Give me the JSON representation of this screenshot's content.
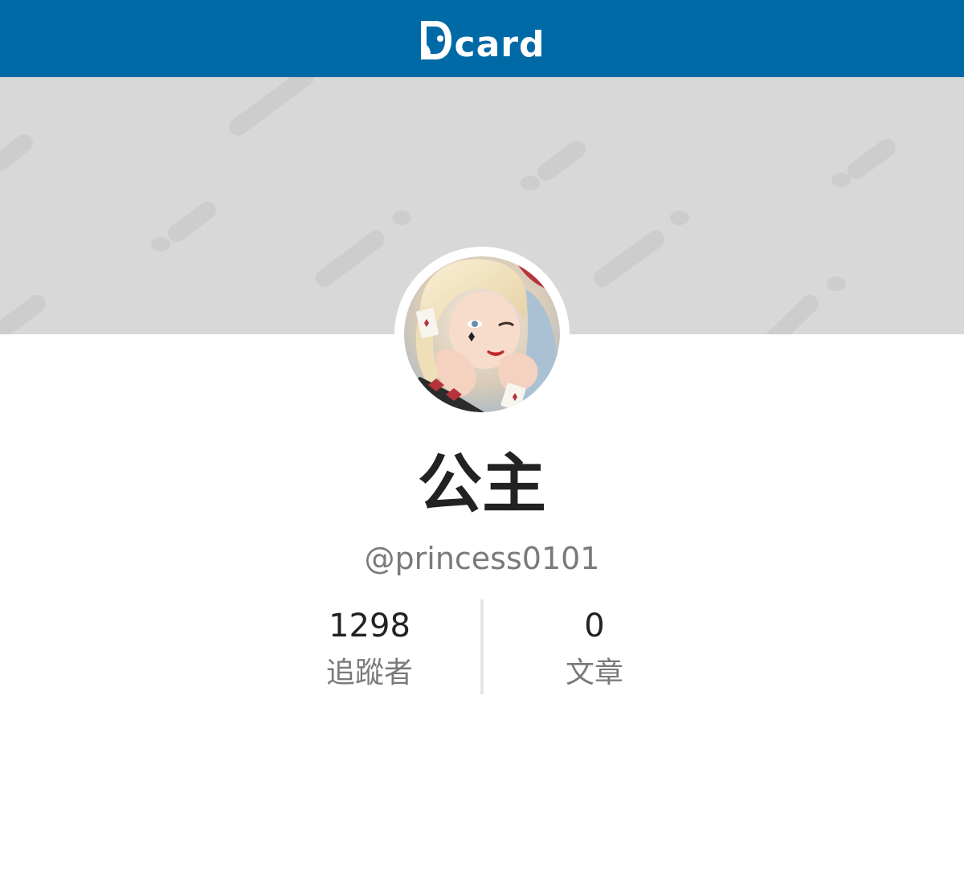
{
  "app": {
    "logo_text": "card",
    "logo_icon": "dcard-logo-icon",
    "brand_color": "#006aa6"
  },
  "cover": {
    "background_color": "#d8d8d8",
    "pattern_color": "#cdcdcd"
  },
  "profile": {
    "avatar_icon": "avatar-image",
    "display_name": "公主",
    "handle": "@princess0101"
  },
  "stats": {
    "followers": {
      "value": "1298",
      "label": "追蹤者"
    },
    "posts": {
      "value": "0",
      "label": "文章"
    }
  }
}
